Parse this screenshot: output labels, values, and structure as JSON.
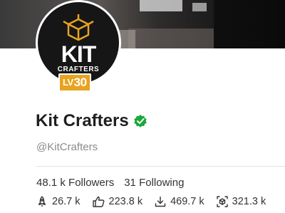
{
  "profile": {
    "display_name": "Kit Crafters",
    "handle": "@KitCrafters",
    "verified": true,
    "verified_color": "#1aa83a",
    "level_badge": {
      "prefix": "LV",
      "value": "30",
      "color": "#e8a320"
    },
    "logo": {
      "line1": "KIT",
      "line2": "CRAFTERS"
    }
  },
  "follow": {
    "followers": "48.1 k Followers",
    "following": "31 Following"
  },
  "stats": [
    {
      "icon": "rocket-icon",
      "value": "26.7 k"
    },
    {
      "icon": "thumbs-up-icon",
      "value": "223.8 k"
    },
    {
      "icon": "download-icon",
      "value": "469.7 k"
    },
    {
      "icon": "cube-scan-icon",
      "value": "321.3 k"
    }
  ]
}
